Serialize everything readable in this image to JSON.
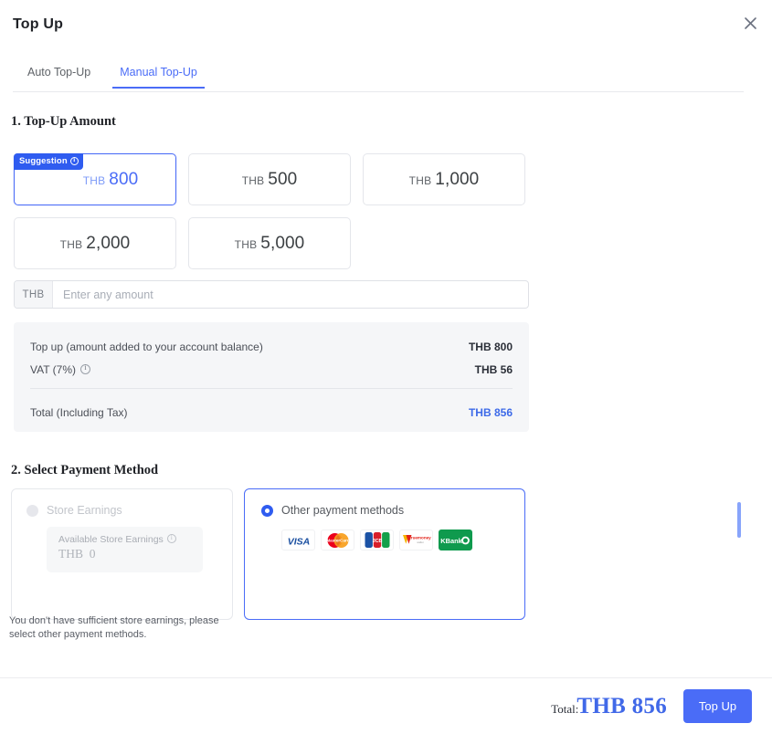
{
  "modal": {
    "title": "Top Up",
    "close_icon": "close-icon"
  },
  "tabs": [
    {
      "label": "Auto Top-Up",
      "active": false
    },
    {
      "label": "Manual Top-Up",
      "active": true
    }
  ],
  "section1": {
    "heading": "1. Top-Up Amount",
    "badge": {
      "label": "Suggestion",
      "icon": "info-icon"
    },
    "currency": "THB",
    "options": [
      {
        "currency": "THB",
        "amount": "800",
        "selected": true,
        "badge": true
      },
      {
        "currency": "THB",
        "amount": "500",
        "selected": false,
        "badge": false
      },
      {
        "currency": "THB",
        "amount": "1,000",
        "selected": false,
        "badge": false
      },
      {
        "currency": "THB",
        "amount": "2,000",
        "selected": false,
        "badge": false
      },
      {
        "currency": "THB",
        "amount": "5,000",
        "selected": false,
        "badge": false
      }
    ],
    "custom_input": {
      "prefix": "THB",
      "placeholder": "Enter any amount",
      "value": ""
    },
    "summary": {
      "rows": [
        {
          "label": "Top up (amount added to your account balance)",
          "value": "THB 800",
          "info": false
        },
        {
          "label": "VAT (7%)",
          "value": "THB 56",
          "info": true
        }
      ],
      "total": {
        "label": "Total (Including Tax)",
        "value": "THB 856"
      }
    }
  },
  "section2": {
    "heading": "2. Select Payment Method",
    "store_earnings": {
      "label": "Store Earnings",
      "selected": false,
      "disabled": true,
      "available_caption": "Available Store Earnings",
      "available_currency": "THB",
      "available_value": "0",
      "info_icon": "info-icon"
    },
    "other_methods": {
      "label": "Other payment methods",
      "selected": true,
      "logos": [
        {
          "name": "visa-logo",
          "text": "VISA"
        },
        {
          "name": "mastercard-logo",
          "text": "MasterCard"
        },
        {
          "name": "jcb-logo",
          "text": "JCB"
        },
        {
          "name": "truemoney-logo",
          "text": "truemoney"
        },
        {
          "name": "kbank-logo",
          "text": "KBank"
        }
      ]
    },
    "note": "You don't have sufficient store earnings, please select other payment methods."
  },
  "footer": {
    "total_label": "Total:",
    "total_value": "THB 856",
    "submit_label": "Top Up"
  },
  "colors": {
    "accent": "#4a6cf7",
    "badge": "#2f5cf0",
    "total": "#4169e8",
    "kbank_green": "#0f9a4e"
  }
}
